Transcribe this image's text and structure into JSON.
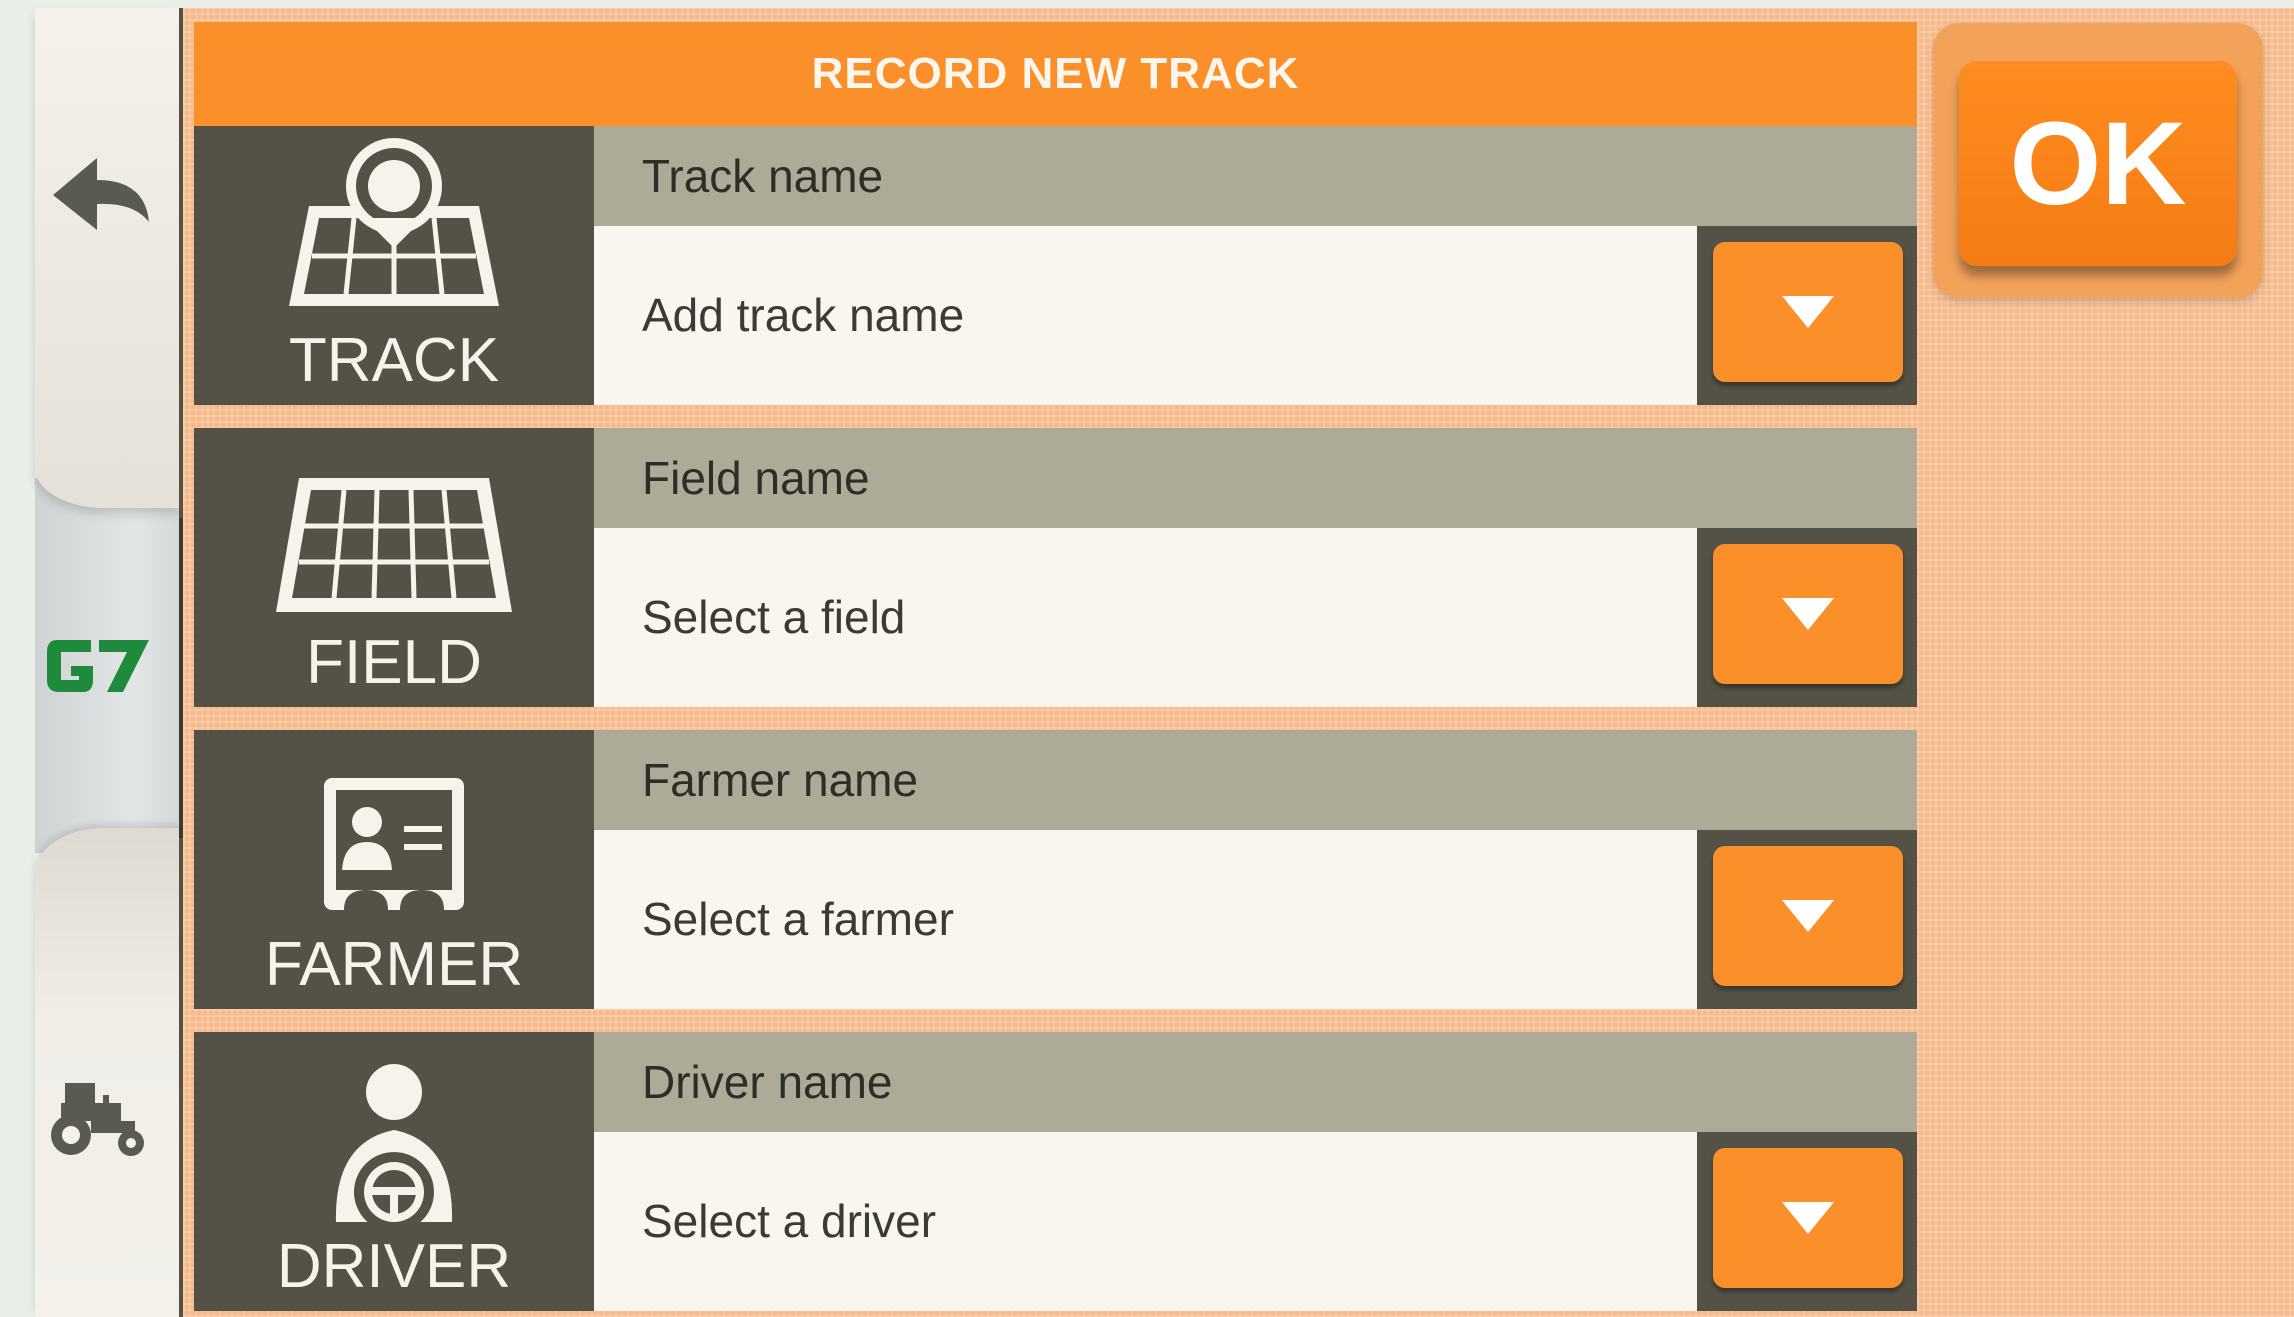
{
  "header": {
    "title": "RECORD NEW TRACK"
  },
  "ok_button": {
    "label": "OK"
  },
  "rail": {
    "back_icon": "back-arrow-icon",
    "logo_text": "G7",
    "tractor_icon": "tractor-icon"
  },
  "rows": [
    {
      "icon_label": "TRACK",
      "title": "Track name",
      "value": "Add track name",
      "icon": "track-pin-grid-icon"
    },
    {
      "icon_label": "FIELD",
      "title": "Field name",
      "value": "Select a field",
      "icon": "field-grid-icon"
    },
    {
      "icon_label": "FARMER",
      "title": "Farmer name",
      "value": "Select a farmer",
      "icon": "farmer-id-card-icon"
    },
    {
      "icon_label": "DRIVER",
      "title": "Driver name",
      "value": "Select a driver",
      "icon": "driver-steering-wheel-icon"
    }
  ],
  "colors": {
    "accent_orange": "#fb8f2a",
    "dark_panel": "#545247",
    "title_bar": "#adab98",
    "logo_green": "#1f8a3c"
  }
}
